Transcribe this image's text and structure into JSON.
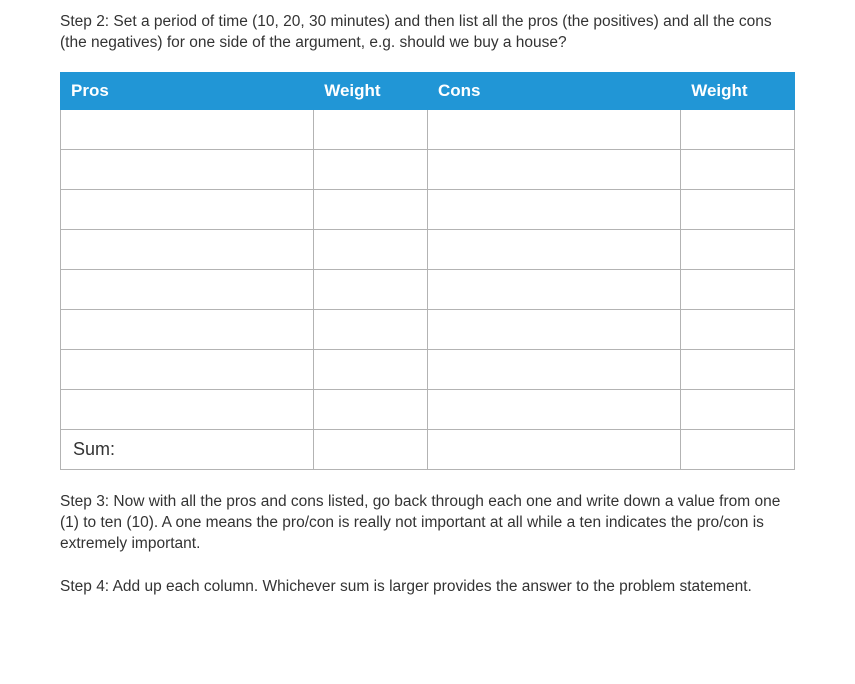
{
  "step2_text": "Step 2: Set a period of time (10, 20, 30 minutes) and then list all the pros (the positives) and all the cons (the negatives) for one side of the argument, e.g. should we buy a house?",
  "table": {
    "headers": {
      "pros": "Pros",
      "weight1": "Weight",
      "cons": "Cons",
      "weight2": "Weight"
    },
    "rows": [
      {
        "pros": "",
        "weight1": "",
        "cons": "",
        "weight2": ""
      },
      {
        "pros": "",
        "weight1": "",
        "cons": "",
        "weight2": ""
      },
      {
        "pros": "",
        "weight1": "",
        "cons": "",
        "weight2": ""
      },
      {
        "pros": "",
        "weight1": "",
        "cons": "",
        "weight2": ""
      },
      {
        "pros": "",
        "weight1": "",
        "cons": "",
        "weight2": ""
      },
      {
        "pros": "",
        "weight1": "",
        "cons": "",
        "weight2": ""
      },
      {
        "pros": "",
        "weight1": "",
        "cons": "",
        "weight2": ""
      },
      {
        "pros": "",
        "weight1": "",
        "cons": "",
        "weight2": ""
      }
    ],
    "sum_label": "Sum:",
    "sum_row": {
      "weight1": "",
      "cons": "",
      "weight2": ""
    }
  },
  "step3_text": "Step 3: Now with all the pros and cons listed, go back through each one and write down a value from one (1) to ten (10). A one means the pro/con is really not important at all while a ten indicates the pro/con is extremely important.",
  "step4_text": "Step 4: Add up each column. Whichever sum is larger provides the answer to the problem statement."
}
